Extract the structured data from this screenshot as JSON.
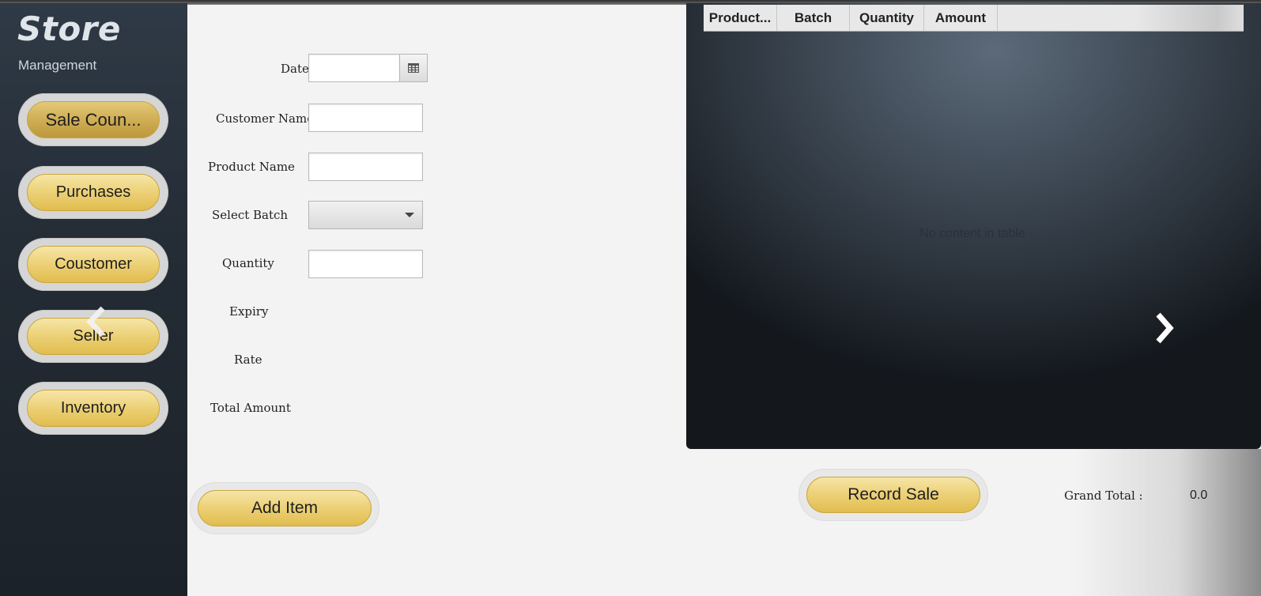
{
  "sidebar": {
    "title": "Store",
    "subtitle": "Management",
    "items": [
      {
        "label": "Sale Coun...",
        "active": true
      },
      {
        "label": "Purchases"
      },
      {
        "label": "Coustomer"
      },
      {
        "label": "Seller"
      },
      {
        "label": "Inventory"
      }
    ]
  },
  "form": {
    "date_label": "Date",
    "date_value": "",
    "customer_name_label": "Customer Name:",
    "customer_name_value": "",
    "product_name_label": "Product Name",
    "product_name_value": "",
    "select_batch_label": "Select Batch",
    "select_batch_value": "",
    "quantity_label": "Quantity",
    "quantity_value": "",
    "expiry_label": "Expiry",
    "rate_label": "Rate",
    "total_amount_label": "Total Amount",
    "add_item_label": "Add Item"
  },
  "table": {
    "columns": [
      "Product...",
      "Batch",
      "Quantity",
      "Amount"
    ],
    "empty_message": "No content in table"
  },
  "footer": {
    "record_sale_label": "Record Sale",
    "grand_total_label": "Grand Total :",
    "grand_total_value": "0.0"
  },
  "icons": {
    "calendar": "calendar-icon",
    "dropdown": "chevron-down-icon",
    "prev": "chevron-left-icon",
    "next": "chevron-right-icon"
  },
  "colors": {
    "button_gold": "#edd27a",
    "sidebar_bg": "#232b34",
    "panel_bg": "#3f4a56"
  }
}
